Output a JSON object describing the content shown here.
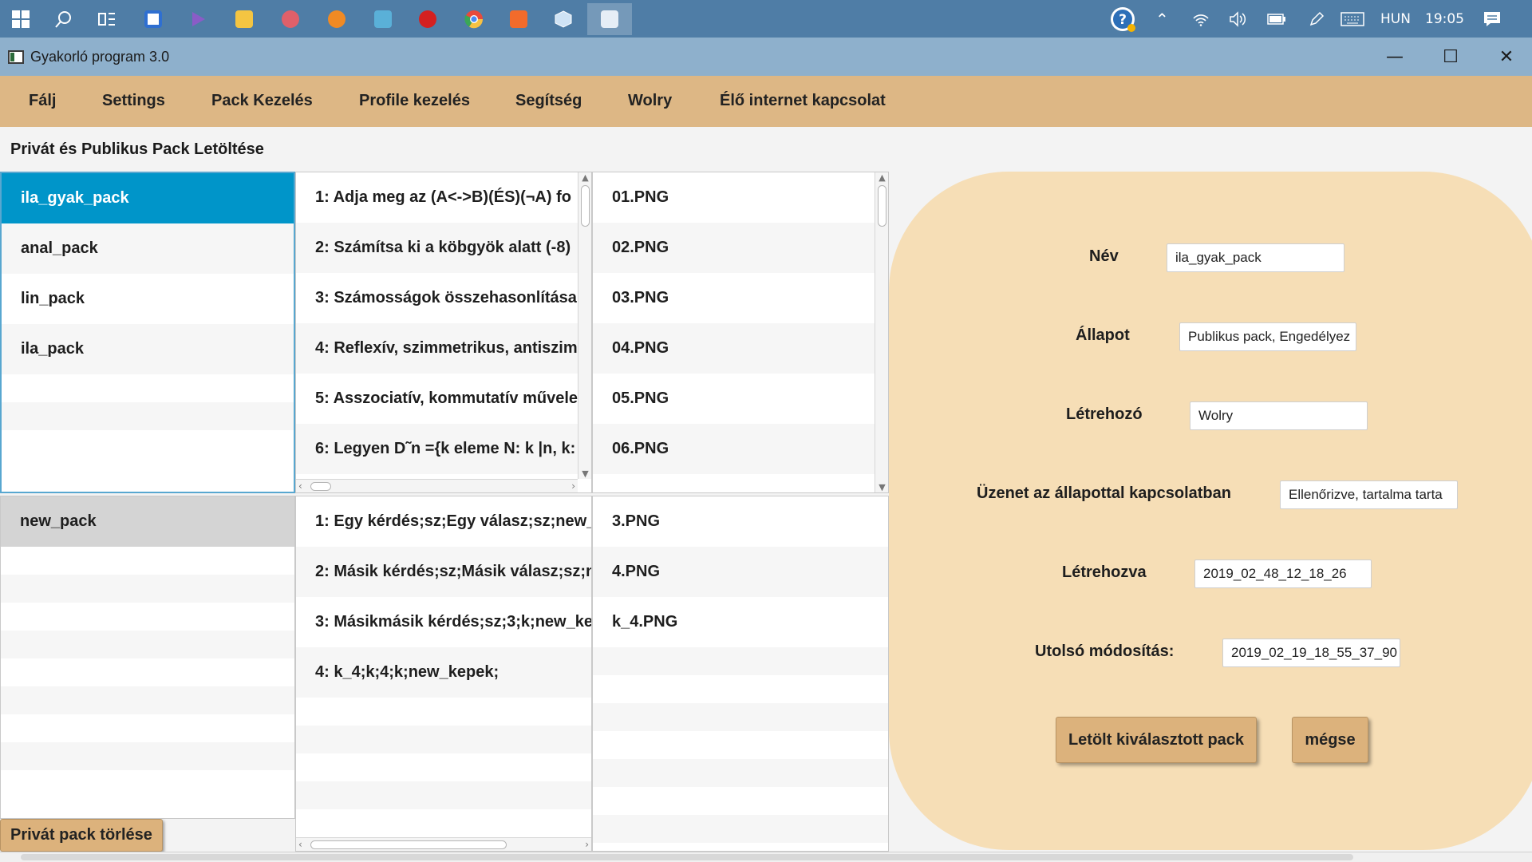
{
  "taskbar": {
    "pinned_icons": [
      {
        "name": "windows-start-icon",
        "color": "#ffffff"
      },
      {
        "name": "search-icon",
        "color": "#ffffff"
      },
      {
        "name": "task-view-icon",
        "color": "#ffffff"
      },
      {
        "name": "store-icon",
        "color": "#f2c94c"
      },
      {
        "name": "visual-studio-icon",
        "color": "#8a5cc7"
      },
      {
        "name": "file-explorer-icon",
        "color": "#f4c542"
      },
      {
        "name": "app-icon-1",
        "color": "#e0606a"
      },
      {
        "name": "app-icon-2",
        "color": "#f08a24"
      },
      {
        "name": "app-icon-3",
        "color": "#5ab0d8"
      },
      {
        "name": "app-icon-4",
        "color": "#d42020"
      },
      {
        "name": "chrome-icon",
        "color": "#e84a3c"
      },
      {
        "name": "xampp-icon",
        "color": "#f26b2b"
      },
      {
        "name": "app-icon-5",
        "color": "#cfe3f5"
      },
      {
        "name": "java-icon",
        "color": "#e6eef6"
      }
    ],
    "tray": {
      "language": "HUN",
      "time": "19:05"
    }
  },
  "window": {
    "title": "Gyakorló program 3.0",
    "minimize": "—",
    "maximize": "☐",
    "close": "✕"
  },
  "menu": {
    "items": [
      "Fálj",
      "Settings",
      "Pack Kezelés",
      "Profile kezelés",
      "Segítség",
      "Wolry",
      "Élő internet kapcsolat"
    ]
  },
  "section_title": "Privát és Publikus Pack Letöltése",
  "public_packs": [
    "ila_gyak_pack",
    "anal_pack",
    "lin_pack",
    "ila_pack"
  ],
  "public_questions": [
    "1: Adja meg az (A<->B)(ÉS)(¬A) fo",
    "2: Számítsa ki a köbgyök alatt (-8)",
    "3: Számosságok összehasonlítása",
    "4: Reflexív, szimmetrikus, antiszim",
    "5: Asszociatív, kommutatív művele",
    "6: Legyen D˜n ={k eleme N: k |n, k:"
  ],
  "public_images": [
    "01.PNG",
    "02.PNG",
    "03.PNG",
    "04.PNG",
    "05.PNG",
    "06.PNG"
  ],
  "private_packs": [
    "new_pack"
  ],
  "private_questions": [
    "1: Egy kérdés;sz;Egy válasz;sz;new_",
    "2: Másik kérdés;sz;Másik válasz;sz;n",
    "3: Másikmásik kérdés;sz;3;k;new_ke",
    "4: k_4;k;4;k;new_kepek;"
  ],
  "private_images": [
    "3.PNG",
    "4.PNG",
    "k_4.PNG"
  ],
  "delete_button": "Privát pack törlése",
  "details": {
    "name_label": "Név",
    "name_value": "ila_gyak_pack",
    "status_label": "Állapot",
    "status_value": "Publikus pack, Engedélyez",
    "creator_label": "Létrehozó",
    "creator_value": "Wolry",
    "message_label": "Üzenet az állapottal kapcsolatban",
    "message_value": "Ellenőrizve, tartalma tarta",
    "created_label": "Létrehozva",
    "created_value": "2019_02_48_12_18_26",
    "modified_label": "Utolsó módosítás:",
    "modified_value": "2019_02_19_18_55_37_90",
    "download_button": "Letölt kiválasztott pack",
    "cancel_button": "mégse"
  },
  "colors": {
    "taskbar": "#4f7da6",
    "titlebar": "#8eb0cc",
    "menubar": "#ddb785",
    "selection": "#0095c9",
    "panel": "#f6deb6",
    "button": "#dcb27c"
  }
}
